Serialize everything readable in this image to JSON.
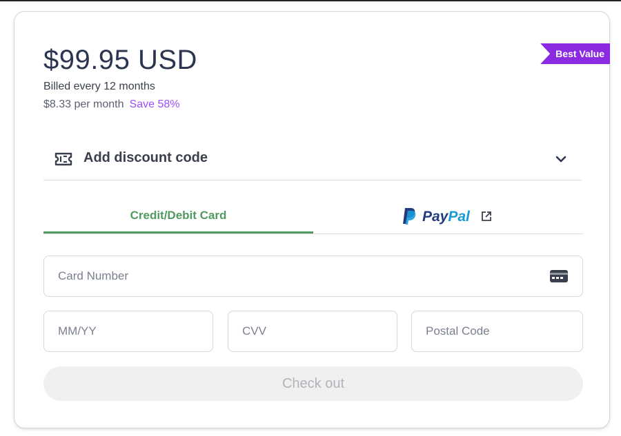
{
  "plan": {
    "price": "$99.95 USD",
    "billed": "Billed every 12 months",
    "per_month": "$8.33 per month",
    "save": "Save 58%",
    "badge": "Best Value"
  },
  "discount": {
    "label": "Add discount code",
    "icon": "ticket-icon",
    "toggle_icon": "chevron-down-icon"
  },
  "tabs": {
    "card_label": "Credit/Debit Card",
    "paypal_pay": "Pay",
    "paypal_pal": "Pal",
    "active": "card"
  },
  "form": {
    "card_number_placeholder": "Card Number",
    "expiry_placeholder": "MM/YY",
    "cvv_placeholder": "CVV",
    "postal_placeholder": "Postal Code",
    "checkout_label": "Check out"
  },
  "colors": {
    "accent_purple": "#8a2be2",
    "save_purple": "#9b4dff",
    "tab_green": "#4f9a61",
    "paypal_dark": "#253b80",
    "paypal_light": "#179bd7"
  }
}
